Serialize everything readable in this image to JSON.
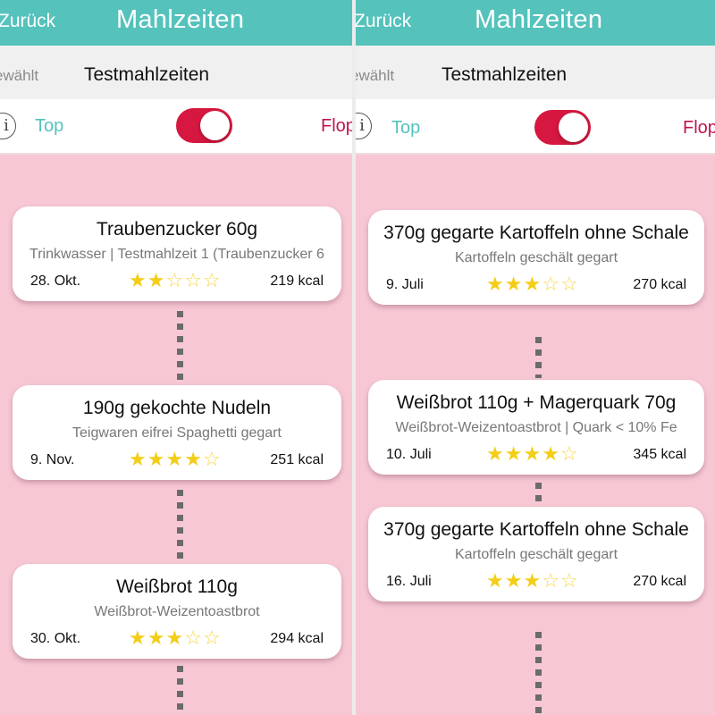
{
  "screens": [
    {
      "navbar": {
        "back_label": "Zurück",
        "title": "Mahlzeiten"
      },
      "filter": {
        "label": "ewählt",
        "value": "Testmahlzeiten"
      },
      "toggle": {
        "info_icon": "info-icon",
        "top_label": "Top",
        "flop_label": "Flop",
        "state": "flop"
      },
      "meals": [
        {
          "title": "Traubenzucker 60g",
          "subtitle": "Trinkwasser | Testmahlzeit 1 (Traubenzucker 6",
          "date": "28. Okt.",
          "rating": 2,
          "kcal": "219 kcal"
        },
        {
          "title": "190g gekochte Nudeln",
          "subtitle": "Teigwaren eifrei Spaghetti gegart",
          "date": "9. Nov.",
          "rating": 4,
          "kcal": "251 kcal"
        },
        {
          "title": "Weißbrot 110g",
          "subtitle": "Weißbrot-Weizentoastbrot",
          "date": "30. Okt.",
          "rating": 3,
          "kcal": "294 kcal"
        }
      ]
    },
    {
      "navbar": {
        "back_label": "Zurück",
        "title": "Mahlzeiten"
      },
      "filter": {
        "label": "ewählt",
        "value": "Testmahlzeiten"
      },
      "toggle": {
        "info_icon": "info-icon",
        "top_label": "Top",
        "flop_label": "Flop",
        "state": "flop"
      },
      "meals": [
        {
          "title": "370g gegarte Kartoffeln ohne Schale",
          "subtitle": "Kartoffeln geschält gegart",
          "date": "9. Juli",
          "rating": 3,
          "kcal": "270 kcal"
        },
        {
          "title": "Weißbrot 110g + Magerquark 70g",
          "subtitle": "Weißbrot-Weizentoastbrot | Quark < 10% Fe",
          "date": "10. Juli",
          "rating": 4,
          "kcal": "345 kcal"
        },
        {
          "title": "370g gegarte Kartoffeln ohne Schale",
          "subtitle": "Kartoffeln geschält gegart",
          "date": "16. Juli",
          "rating": 3,
          "kcal": "270 kcal"
        }
      ]
    }
  ],
  "rating_max": 5,
  "colors": {
    "header": "#55c2bc",
    "toggle_on": "#d6173f",
    "flop": "#c0154b",
    "background": "#f7c8d4",
    "star": "#f4cd18"
  }
}
